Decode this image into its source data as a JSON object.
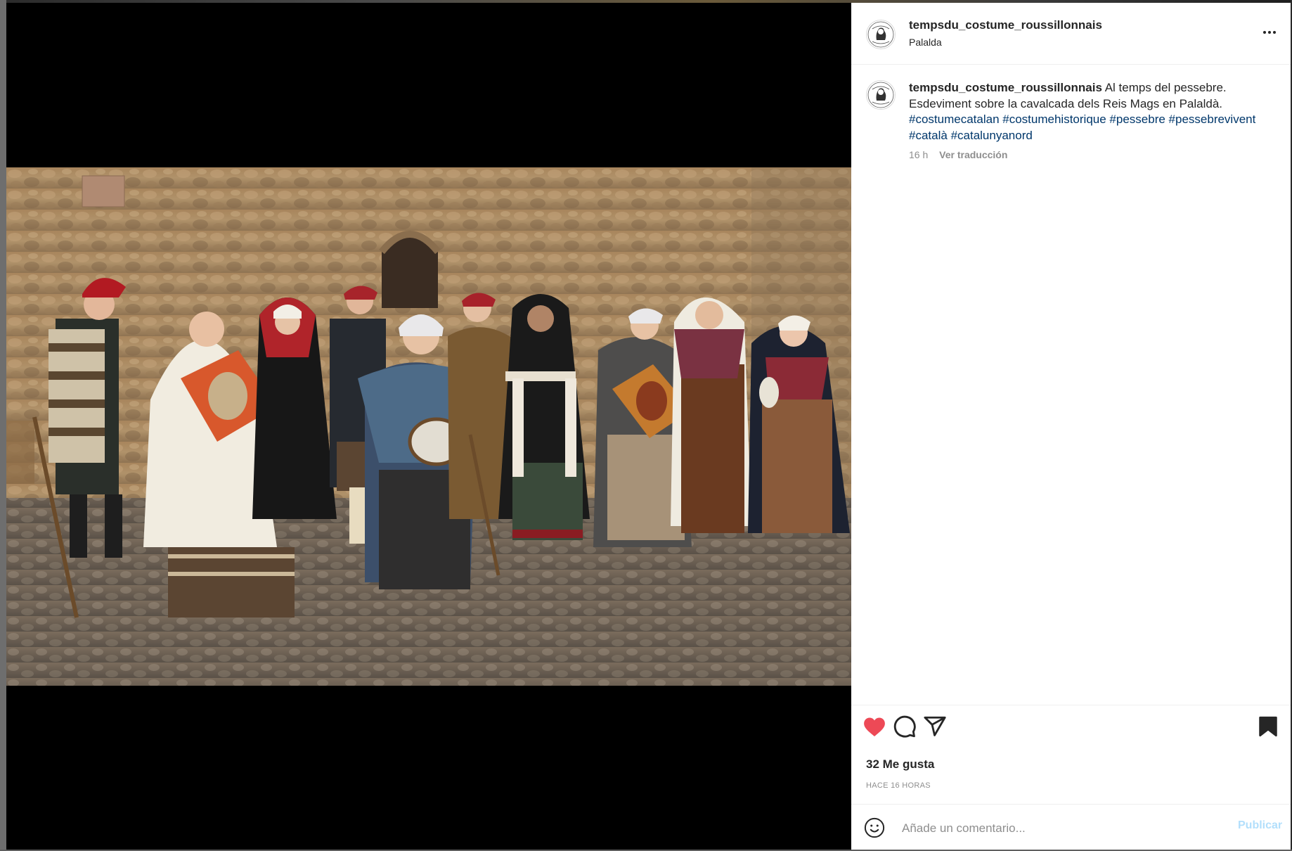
{
  "colors": {
    "accent": "#0095f6",
    "like": "#ed4956",
    "hashtag": "#00376b",
    "muted": "#8e8e8e"
  },
  "post": {
    "username": "tempsdu_costume_roussillonnais",
    "location": "Palalda",
    "caption_line1": "Al temps del pessebre.",
    "caption_line2": "Esdeviment sobre la cavalcada dels Reis Mags en Palaldà.",
    "hashtags": [
      "#costumecatalan",
      "#costumehistorique",
      "#pessebre",
      "#pessebrevivent",
      "#català",
      "#catalunyanord"
    ],
    "time": "16 h",
    "translate": "Ver traducción",
    "likes": "32 Me gusta",
    "time_ago": "HACE 16 HORAS",
    "comment_placeholder": "Añade un comentario...",
    "publish": "Publicar"
  },
  "icons": {
    "more": "more-options-icon",
    "like": "heart-filled-icon",
    "comment": "comment-bubble-icon",
    "share": "paper-plane-icon",
    "save": "bookmark-filled-icon",
    "emoji": "smiley-emoji-icon"
  }
}
